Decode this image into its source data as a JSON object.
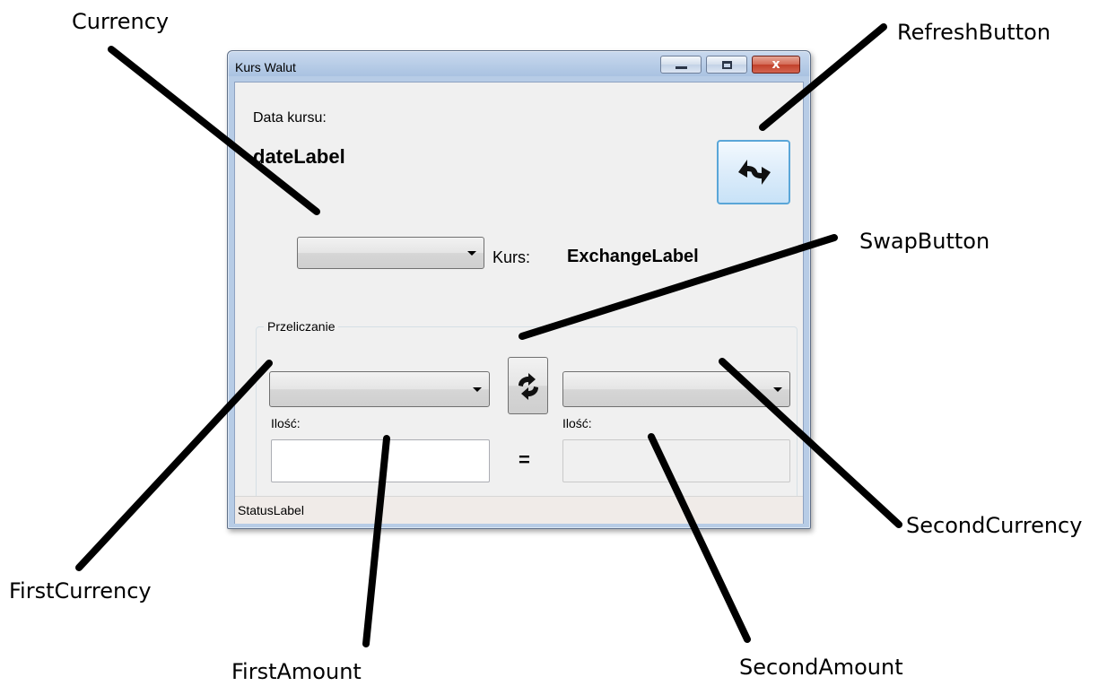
{
  "window": {
    "title": "Kurs Walut",
    "close_glyph": "x"
  },
  "form": {
    "date_caption": "Data kursu:",
    "date_value": "dateLabel",
    "rate_caption": "Kurs:",
    "rate_value": "ExchangeLabel",
    "conversion_group_title": "Przeliczanie",
    "amount_caption_1": "Ilość:",
    "amount_caption_2": "Ilość:",
    "equals_sign": "=",
    "first_amount_value": "",
    "second_amount_value": "",
    "status": "StatusLabel"
  },
  "annotations": {
    "currency": "Currency",
    "refresh_button": "RefreshButton",
    "swap_button": "SwapButton",
    "second_currency": "SecondCurrency",
    "first_currency": "FirstCurrency",
    "first_amount": "FirstAmount",
    "second_amount": "SecondAmount"
  },
  "icons": {
    "refresh": "refresh-arrows-icon",
    "swap": "swap-arrows-icon",
    "dropdown": "chevron-down-icon",
    "minimize": "minimize-icon",
    "maximize": "maximize-icon",
    "close": "close-icon"
  },
  "colors": {
    "title_bar": "#b7cce6",
    "close_button": "#c2402a",
    "refresh_border": "#5aa6d8",
    "client_background": "#f0f0f0"
  }
}
